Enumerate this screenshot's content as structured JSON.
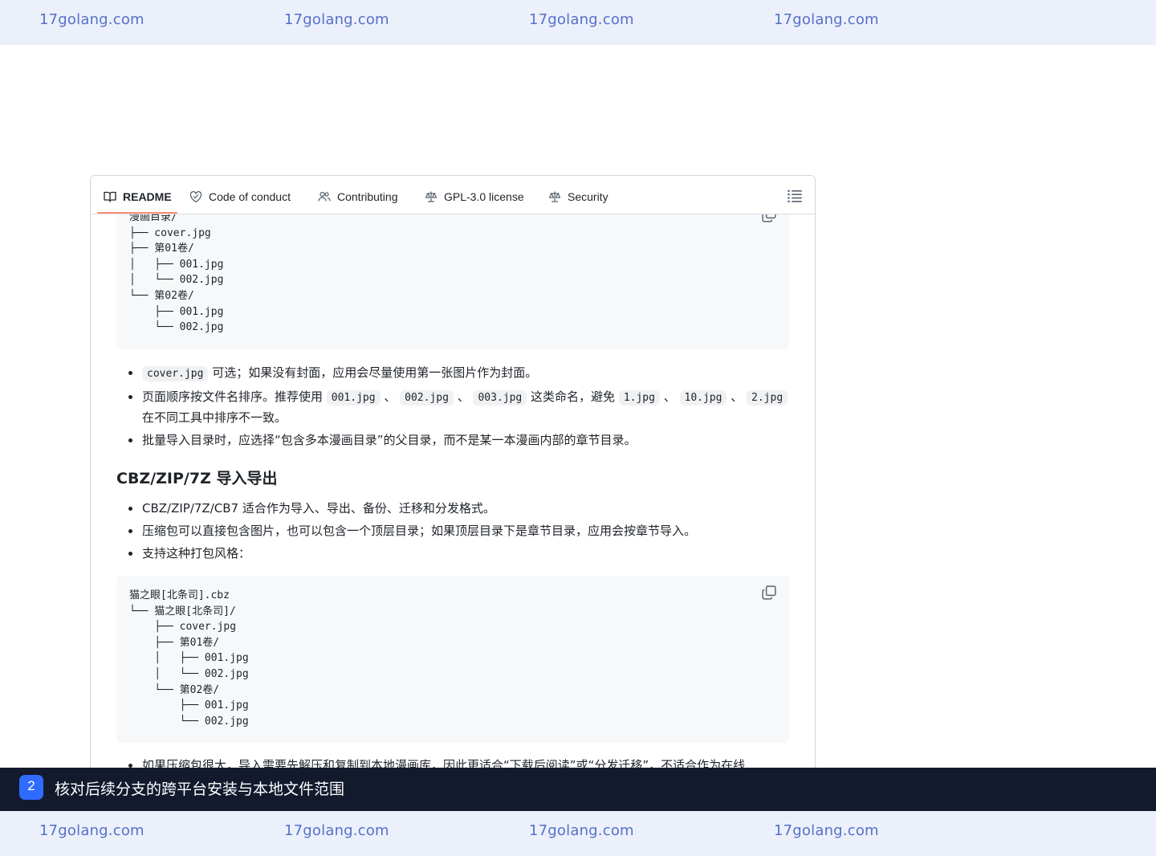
{
  "watermark": {
    "text": "17golang.com"
  },
  "tabs": {
    "readme": "README",
    "code_of_conduct": "Code of conduct",
    "contributing": "Contributing",
    "license": "GPL-3.0 license",
    "security": "Security"
  },
  "code_block_1": {
    "lines": "漫画目录/\n├── cover.jpg\n├── 第01卷/\n│   ├── 001.jpg\n│   └── 002.jpg\n└── 第02卷/\n    ├── 001.jpg\n    └── 002.jpg"
  },
  "bullets_1": {
    "item1_code": "cover.jpg",
    "item1_text": " 可选；如果没有封面，应用会尽量使用第一张图片作为封面。",
    "item2_pre": "页面顺序按文件名排序。推荐使用 ",
    "item2_code1": "001.jpg",
    "item2_sep1": " 、 ",
    "item2_code2": "002.jpg",
    "item2_sep2": " 、 ",
    "item2_code3": "003.jpg",
    "item2_mid": " 这类命名，避免 ",
    "item2_code4": "1.jpg",
    "item2_sep3": " 、 ",
    "item2_code5": "10.jpg",
    "item2_sep4": " 、 ",
    "item2_code6": "2.jpg",
    "item2_post": " 在不同工具中排序不一致。",
    "item3": "批量导入目录时，应选择“包含多本漫画目录”的父目录，而不是某一本漫画内部的章节目录。"
  },
  "section_heading": "CBZ/ZIP/7Z 导入导出",
  "bullets_2": {
    "item1": "CBZ/ZIP/7Z/CB7 适合作为导入、导出、备份、迁移和分发格式。",
    "item2": "压缩包可以直接包含图片，也可以包含一个顶层目录；如果顶层目录下是章节目录，应用会按章节导入。",
    "item3": "支持这种打包风格："
  },
  "code_block_2": {
    "lines": "猫之眼[北条司].cbz\n└── 猫之眼[北条司]/\n    ├── cover.jpg\n    ├── 第01卷/\n    │   ├── 001.jpg\n    │   └── 002.jpg\n    └── 第02卷/\n        ├── 001.jpg\n        └── 002.jpg"
  },
  "bullets_3": {
    "item1": "如果压缩包很大，导入需要先解压和复制到本地漫画库，因此更适合“下载后阅读”或“分发迁移”，不适合作为在线"
  },
  "step": {
    "number": "2",
    "title": "核对后续分支的跨平台安装与本地文件范围"
  }
}
